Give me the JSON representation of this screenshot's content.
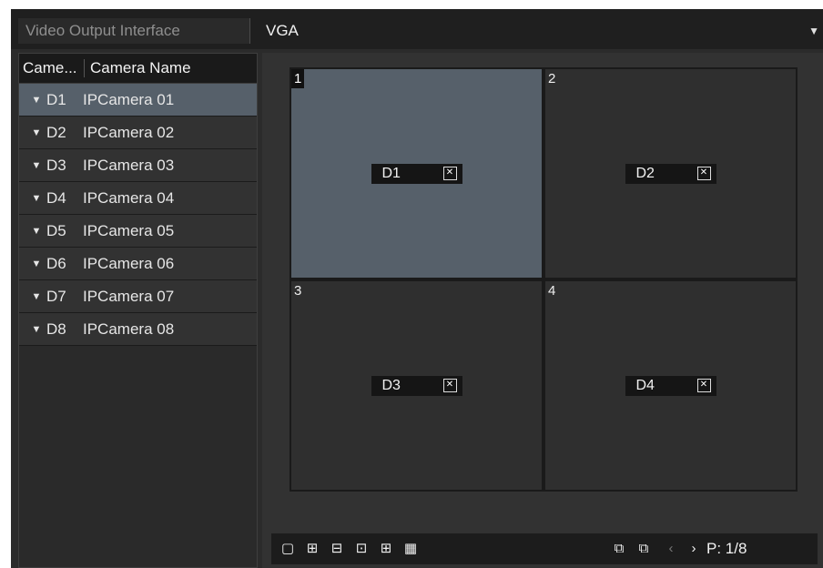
{
  "top": {
    "label": "Video Output Interface",
    "value": "VGA"
  },
  "camera_list": {
    "headers": [
      "Came...",
      "Camera Name"
    ],
    "rows": [
      {
        "id": "D1",
        "name": "IPCamera 01",
        "selected": true
      },
      {
        "id": "D2",
        "name": "IPCamera 02"
      },
      {
        "id": "D3",
        "name": "IPCamera 03"
      },
      {
        "id": "D4",
        "name": "IPCamera 04"
      },
      {
        "id": "D5",
        "name": "IPCamera 05"
      },
      {
        "id": "D6",
        "name": "IPCamera 06"
      },
      {
        "id": "D7",
        "name": "IPCamera 07"
      },
      {
        "id": "D8",
        "name": "IPCamera 08"
      }
    ]
  },
  "grid": {
    "cells": [
      {
        "num": "1",
        "camera": "D1"
      },
      {
        "num": "2",
        "camera": "D2"
      },
      {
        "num": "3",
        "camera": "D3"
      },
      {
        "num": "4",
        "camera": "D4"
      }
    ]
  },
  "toolbar": {
    "page": "P: 1/8"
  },
  "icons": {
    "layout": [
      "layout-1-icon",
      "layout-4-icon",
      "layout-6-icon",
      "layout-8-icon",
      "layout-9-icon",
      "layout-16-icon"
    ],
    "sequence": [
      "start-sequence-icon",
      "stop-sequence-icon"
    ],
    "nav": [
      "prev-page-icon",
      "next-page-icon"
    ]
  },
  "colors": {
    "selected_row": "#56606a",
    "active_cell": "#56606a",
    "panel": "#2b2b2b"
  }
}
